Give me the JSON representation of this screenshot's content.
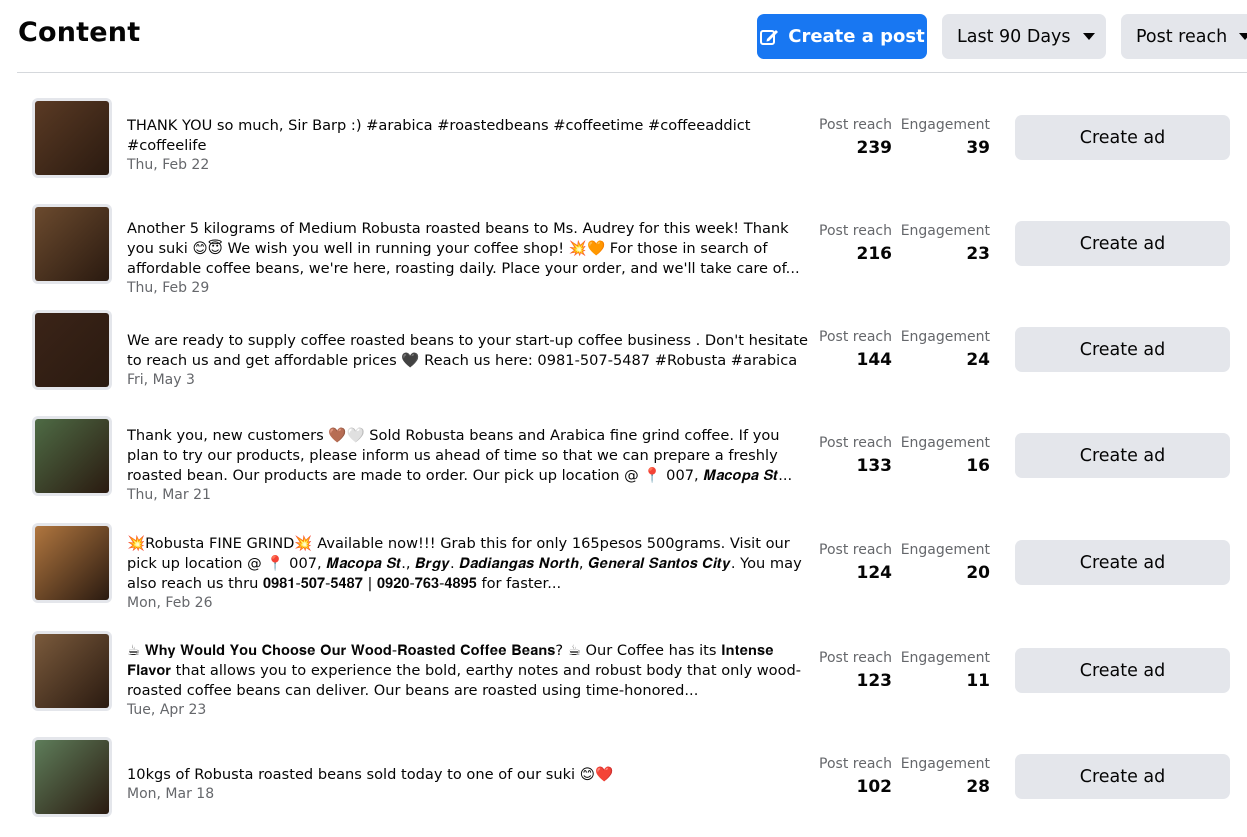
{
  "header": {
    "title": "Content",
    "create_post_label": "Create a post",
    "date_range_label": "Last 90 Days",
    "sort_label": "Post reach"
  },
  "columns": {
    "reach_label": "Post reach",
    "engagement_label": "Engagement"
  },
  "posts": [
    {
      "text": "THANK YOU so much, Sir Barp :) #arabica #roastedbeans #coffeetime #coffeeaddict #coffeelife",
      "date": "Thu, Feb 22",
      "reach": "239",
      "engagement": "39",
      "action": "Create ad",
      "thumb_color": "#5a3a24"
    },
    {
      "text": "Another 5 kilograms of Medium Robusta roasted beans to Ms. Audrey for this week! Thank you suki 😊😇 We wish you well in running your coffee shop! 💥🧡 For those in search of affordable coffee beans, we're here, roasting daily. Place your order, and we'll take care of...",
      "date": "Thu, Feb 29",
      "reach": "216",
      "engagement": "23",
      "action": "Create ad",
      "thumb_color": "#6b4a2e"
    },
    {
      "text": "We are ready to supply coffee roasted beans to your start-up coffee business . Don't hesitate to reach us and get affordable prices 🖤 Reach us here: 0981-507-5487 #Robusta #arabica",
      "date": "Fri, May 3",
      "reach": "144",
      "engagement": "24",
      "action": "Create ad",
      "thumb_color": "#3b2418"
    },
    {
      "text": "Thank you, new customers 🤎🤍 Sold Robusta beans and Arabica fine grind coffee. If you plan to try our products, please inform us ahead of time so that we can prepare a freshly roasted bean. Our products are made to order. Our pick up location @ 📍 007, 𝑴𝒂𝒄𝒐𝒑𝒂 𝑺𝒕...",
      "date": "Thu, Mar 21",
      "reach": "133",
      "engagement": "16",
      "action": "Create ad",
      "thumb_color": "#4e6b45"
    },
    {
      "text": "💥Robusta FINE GRIND💥 Available now!!! Grab this for only 165pesos 500grams. Visit our pick up location @ 📍 007, 𝑴𝒂𝒄𝒐𝒑𝒂 𝑺𝒕., 𝑩𝒓𝒈𝒚. 𝑫𝒂𝒅𝒊𝒂𝒏𝒈𝒂𝒔 𝑵𝒐𝒓𝒕𝒉, 𝑮𝒆𝒏𝒆𝒓𝒂𝒍 𝑺𝒂𝒏𝒕𝒐𝒔 𝑪𝒊𝒕𝒚. You may also reach us thru 𝟎𝟗𝟖𝟏-𝟓𝟎𝟕-𝟓𝟒𝟖𝟕 | 𝟎𝟗𝟐𝟎-𝟕𝟔𝟑-𝟒𝟖𝟗𝟓 for faster...",
      "date": "Mon, Feb 26",
      "reach": "124",
      "engagement": "20",
      "action": "Create ad",
      "thumb_color": "#b0763f"
    },
    {
      "text": "☕ 𝐖𝐡𝐲 𝐖𝐨𝐮𝐥𝐝 𝐘𝐨𝐮 𝐂𝐡𝐨𝐨𝐬𝐞 𝐎𝐮𝐫 𝐖𝐨𝐨𝐝-𝐑𝐨𝐚𝐬𝐭𝐞𝐝 𝐂𝐨𝐟𝐟𝐞𝐞 𝐁𝐞𝐚𝐧𝐬? ☕ Our Coffee has its 𝐈𝐧𝐭𝐞𝐧𝐬𝐞 𝐅𝐥𝐚𝐯𝐨𝐫 that allows you to experience the bold, earthy notes and robust body that only wood-roasted coffee beans can deliver. Our beans are roasted using time-honored...",
      "date": "Tue, Apr 23",
      "reach": "123",
      "engagement": "11",
      "action": "Create ad",
      "thumb_color": "#7a5a3c"
    },
    {
      "text": "10kgs of Robusta roasted beans sold today to one of our suki 😊❤️",
      "date": "Mon, Mar 18",
      "reach": "102",
      "engagement": "28",
      "action": "Create ad",
      "thumb_color": "#5e7d5a"
    }
  ]
}
